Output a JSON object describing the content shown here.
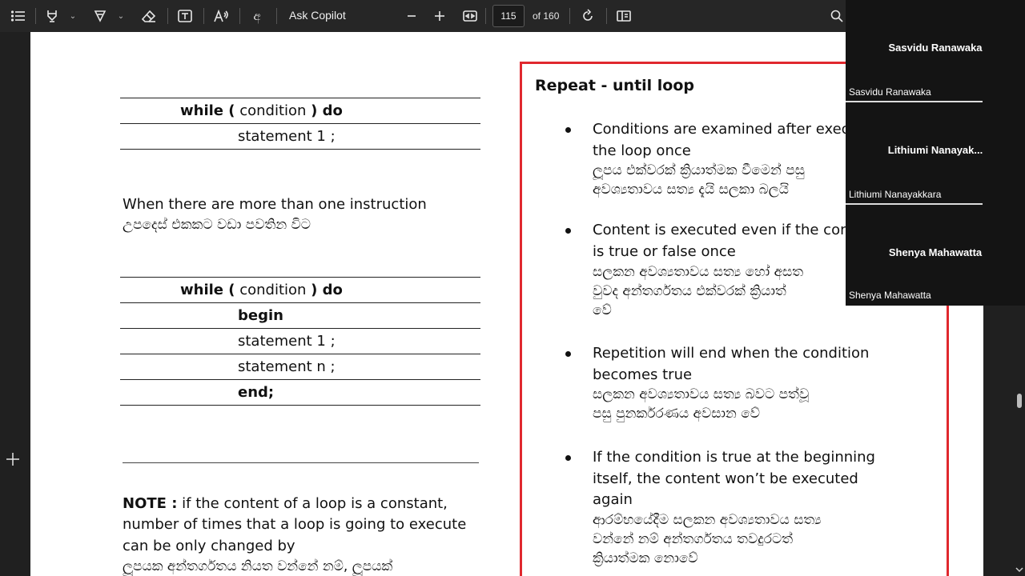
{
  "toolbar": {
    "ask_copilot": "Ask Copilot",
    "current_page": "115",
    "page_total": "of 160",
    "icons": [
      "contents-icon",
      "highlight-icon",
      "draw-icon",
      "eraser-icon",
      "text-box-icon",
      "read-aloud-icon",
      "translate-icon",
      "zoom-out-icon",
      "zoom-in-icon",
      "fit-page-icon",
      "rotate-icon",
      "page-view-icon",
      "search-icon"
    ],
    "translate_glyph": "අ"
  },
  "left": {
    "row1": {
      "kw1": "while (",
      "cond": " condition ",
      "kw2": ") do"
    },
    "row1_stmt": "statement 1 ;",
    "para_en": "When there are more than one instruction",
    "para_si": "උපදෙස් එකකට වඩා පවතින විට",
    "row2": {
      "kw1": "while (",
      "cond": " condition ",
      "kw2": ") do"
    },
    "begin": "begin",
    "stmt1": "statement 1 ;",
    "stmtn": "statement n ;",
    "end": "end;",
    "note_label": "NOTE :",
    "note_line1": " if the content of a loop is a constant,",
    "note_line2": "number of times that a loop is going to execute",
    "note_line3": "can be only changed by",
    "note_si": "ලූපයක අන්තර්ගතය නියත වන්නේ නම්, ලූපයක්"
  },
  "right": {
    "title": "Repeat - until loop",
    "b1_en1": "Conditions are examined after exec",
    "b1_en2": "the loop once",
    "b1_si1": "ලූපය එක්වරක් ක්‍රියාත්මක වීමෙන් පසු",
    "b1_si2": "අවශ්‍යතාවය සත්‍ය දැයි සලකා බලයි",
    "b2_en1": "Content is executed even if the con",
    "b2_en2": "is true or false once",
    "b2_si1": "සලකන අවශ්‍යතාවය සත්‍ය හෝ අසත",
    "b2_si2": "වුවද  අන්තර්ගතය එක්වරක් ක්‍රියාත්",
    "b2_si3": "වේ",
    "b3_en1": "Repetition will end when the condition",
    "b3_en2": "becomes true",
    "b3_si1": "සලකන අවශ්‍යතාවය සත්‍ය  බවට පත්වූ",
    "b3_si2": "පසු පුනර්කරණය අවසාන වේ",
    "b4_en1": "If the condition is true at the beginning",
    "b4_en2": "itself, the content won’t be executed",
    "b4_en3": "again",
    "b4_si1": "ආරම්භයේදීම සලකන අවශ්‍යතාවය සත්‍ය",
    "b4_si2": "වන්නේ නම් අන්තර්ගතය තවදුරටත්",
    "b4_si3": "ක්‍රියාත්මක නොවේ"
  },
  "participants": [
    {
      "display": "Sasvidu Ranawaka",
      "label": "Sasvidu Ranawaka"
    },
    {
      "display": "Lithiumi  Nanayak...",
      "label": "Lithiumi Nanayakkara"
    },
    {
      "display": "Shenya Mahawatta",
      "label": "Shenya Mahawatta"
    }
  ],
  "colors": {
    "accent_red": "#e0282e",
    "toolbar_bg": "#262626",
    "participant_bg": "#141414"
  }
}
